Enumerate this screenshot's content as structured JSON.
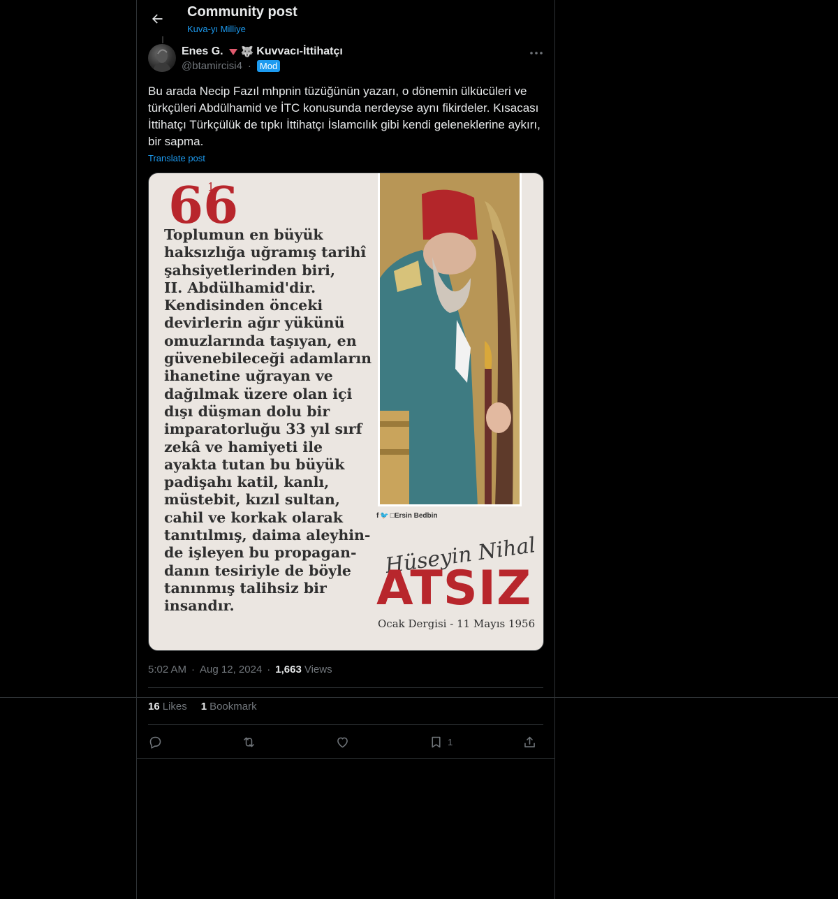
{
  "header": {
    "title": "Community post",
    "community": "Kuva-yı Milliye"
  },
  "post": {
    "author_name": "Enes G.",
    "author_suffix": "Kuvvacı-İttihatçı",
    "handle": "@btamircisi4",
    "separator": "·",
    "badge": "Mod",
    "text": "Bu arada Necip Fazıl mhpnin tüzüğünün yazarı, o dönemin ülkücüleri ve türkçüleri Abdülhamid ve İTC konusunda nerdeyse aynı fikirdeler. Kısacası İttihatçı Türkçülük de tıpkı İttihatçı İslamcılık gibi kendi geleneklerine aykırı, bir sapma.",
    "translate_label": "Translate post",
    "time": "5:02 AM",
    "date": "Aug 12, 2024",
    "views_count": "1,663",
    "views_label": "Views",
    "likes_count": "16",
    "likes_label": "Likes",
    "bookmarks_count": "1",
    "bookmarks_label": "Bookmark",
    "bookmark_action_count": "1"
  },
  "image": {
    "quote_mark": "66",
    "footnote": "1",
    "quote": "Toplumun en büyük\nhaksızlığa uğramış tarihî\nşahsiyetlerinden biri,\nII. Abdülhamid'dir.\nKendisinden önceki\ndevirlerin ağır yükünü\nomuzlarında taşıyan, en\ngüvenebileceği adamların\nihanetine uğrayan ve\ndağılmak üzere olan içi\ndışı düşman dolu bir\nimparatorluğu 33 yıl sırf\nzekâ ve hamiyeti ile\nayakta tutan bu büyük\npadişahı katil, kanlı,\nmüstebit, kızıl sultan,\ncahil ve korkak olarak\ntanıtılmış, daima aleyhin-\nde işleyen bu propagan-\ndanın tesiriyle de böyle\ntanınmış talihsiz bir\ninsandır.",
    "credit": "f 🐦 □Ersin Bedbin",
    "signature": "Hüseyin Nihal",
    "author": "ATSIZ",
    "source": "Ocak Dergisi - 11 Mayıs 1956"
  },
  "colors": {
    "background": "#000000",
    "accent": "#1d9bf0",
    "text": "#e7e9ea",
    "muted": "#71767b",
    "poster_red": "#b8262c"
  },
  "icons": [
    "back-arrow-icon",
    "more-icon",
    "reply-icon",
    "repost-icon",
    "like-icon",
    "bookmark-icon",
    "share-icon"
  ]
}
